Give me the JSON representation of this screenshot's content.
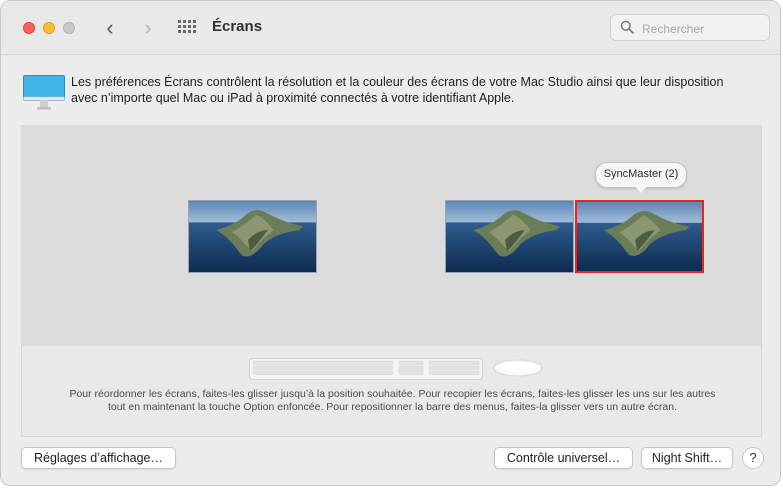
{
  "window": {
    "title": "Écrans"
  },
  "search": {
    "placeholder": "Rechercher"
  },
  "description": "Les préférences Écrans contrôlent la résolution et la couleur des écrans de votre Mac Studio ainsi que leur disposition avec n’importe quel Mac ou iPad à proximité connectés à votre identifiant Apple.",
  "arrangement": {
    "tooltip": "SyncMaster (2)",
    "hint": "Pour réordonner les écrans, faites-les glisser jusqu’à la position souhaitée. Pour recopier les écrans, faites-les glisser les uns sur les autres tout en maintenant la touche Option enfoncée. Pour repositionner la barre des menus, faites-la glisser vers un autre écran.",
    "selected_display_border": "#e0252b"
  },
  "buttons": {
    "display_settings": "Réglages d’affichage…",
    "universal_control": "Contrôle universel…",
    "night_shift": "Night Shift…",
    "help": "?"
  },
  "icons": {
    "close": "traffic-close",
    "minimize": "traffic-minimize",
    "zoom": "traffic-zoom",
    "back": "‹",
    "forward": "›",
    "grid": "grid-icon",
    "search": "search-icon",
    "monitor": "monitor-icon",
    "keyboard": "keyboard-icon",
    "mouse": "mouse-icon"
  }
}
